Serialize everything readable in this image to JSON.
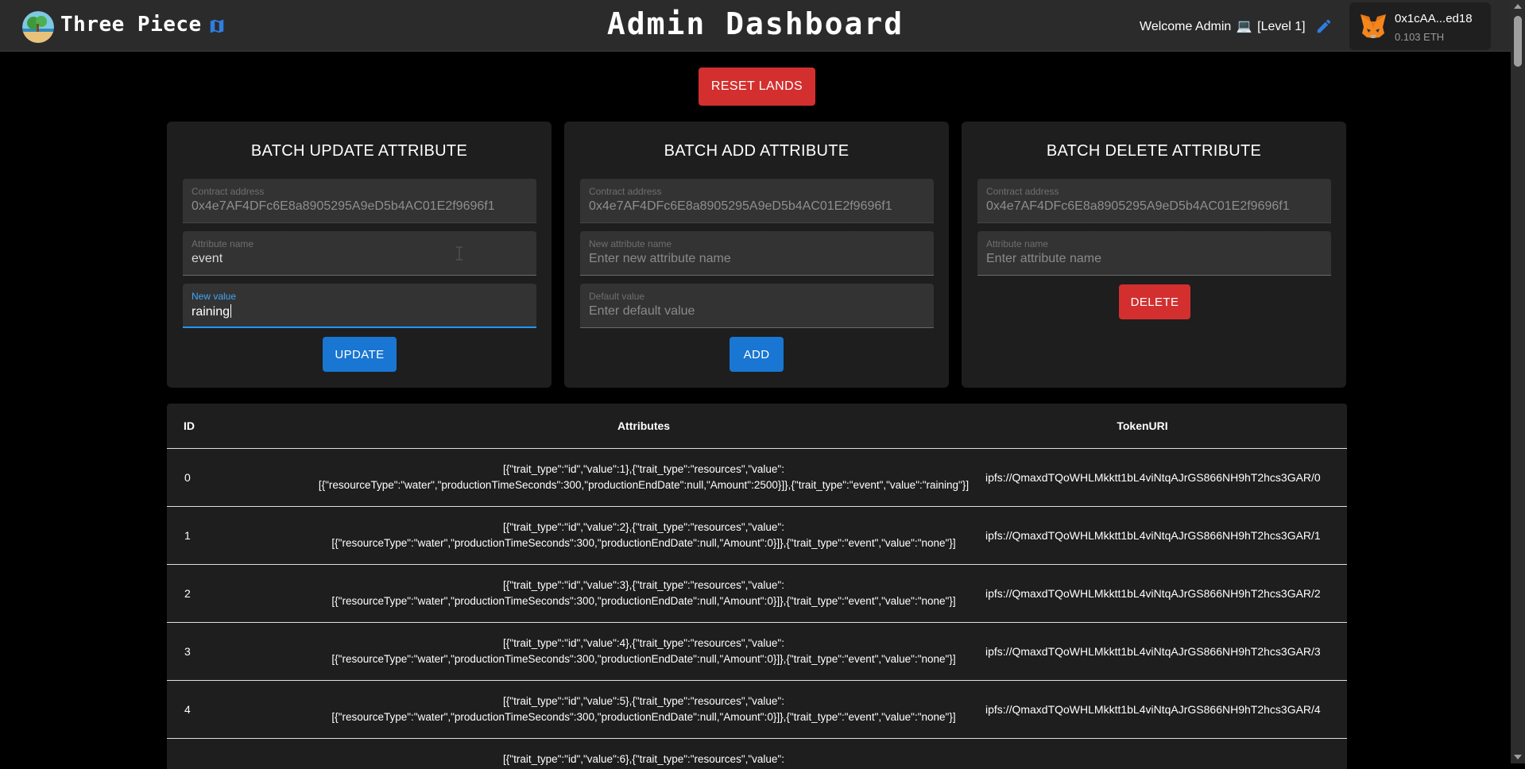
{
  "header": {
    "brand": "Three Piece",
    "title": "Admin Dashboard",
    "welcome": "Welcome Admin",
    "welcome_emoji": "💻",
    "level": "[Level 1]",
    "wallet_address": "0x1cAA...ed18",
    "wallet_balance": "0.103 ETH"
  },
  "actions": {
    "reset_label": "RESET LANDS"
  },
  "panels": {
    "update": {
      "title": "BATCH UPDATE ATTRIBUTE",
      "contract_label": "Contract address",
      "contract_value": "0x4e7AF4DFc6E8a8905295A9eD5b4AC01E2f9696f1",
      "attr_label": "Attribute name",
      "attr_value": "event",
      "new_value_label": "New value",
      "new_value": "raining",
      "button": "UPDATE"
    },
    "add": {
      "title": "BATCH ADD ATTRIBUTE",
      "contract_label": "Contract address",
      "contract_value": "0x4e7AF4DFc6E8a8905295A9eD5b4AC01E2f9696f1",
      "attr_label": "New attribute name",
      "attr_placeholder": "Enter new attribute name",
      "default_label": "Default value",
      "default_placeholder": "Enter default value",
      "button": "ADD"
    },
    "delete": {
      "title": "BATCH DELETE ATTRIBUTE",
      "contract_label": "Contract address",
      "contract_value": "0x4e7AF4DFc6E8a8905295A9eD5b4AC01E2f9696f1",
      "attr_label": "Attribute name",
      "attr_placeholder": "Enter attribute name",
      "button": "DELETE"
    }
  },
  "table": {
    "headers": {
      "id": "ID",
      "attributes": "Attributes",
      "token_uri": "TokenURI"
    },
    "rows": [
      {
        "id": "0",
        "attr_line1": "[{\"trait_type\":\"id\",\"value\":1},{\"trait_type\":\"resources\",\"value\":",
        "attr_line2": "[{\"resourceType\":\"water\",\"productionTimeSeconds\":300,\"productionEndDate\":null,\"Amount\":2500}]},{\"trait_type\":\"event\",\"value\":\"raining\"}]",
        "uri": "ipfs://QmaxdTQoWHLMkktt1bL4viNtqAJrGS866NH9hT2hcs3GAR/0"
      },
      {
        "id": "1",
        "attr_line1": "[{\"trait_type\":\"id\",\"value\":2},{\"trait_type\":\"resources\",\"value\":",
        "attr_line2": "[{\"resourceType\":\"water\",\"productionTimeSeconds\":300,\"productionEndDate\":null,\"Amount\":0}]},{\"trait_type\":\"event\",\"value\":\"none\"}]",
        "uri": "ipfs://QmaxdTQoWHLMkktt1bL4viNtqAJrGS866NH9hT2hcs3GAR/1"
      },
      {
        "id": "2",
        "attr_line1": "[{\"trait_type\":\"id\",\"value\":3},{\"trait_type\":\"resources\",\"value\":",
        "attr_line2": "[{\"resourceType\":\"water\",\"productionTimeSeconds\":300,\"productionEndDate\":null,\"Amount\":0}]},{\"trait_type\":\"event\",\"value\":\"none\"}]",
        "uri": "ipfs://QmaxdTQoWHLMkktt1bL4viNtqAJrGS866NH9hT2hcs3GAR/2"
      },
      {
        "id": "3",
        "attr_line1": "[{\"trait_type\":\"id\",\"value\":4},{\"trait_type\":\"resources\",\"value\":",
        "attr_line2": "[{\"resourceType\":\"water\",\"productionTimeSeconds\":300,\"productionEndDate\":null,\"Amount\":0}]},{\"trait_type\":\"event\",\"value\":\"none\"}]",
        "uri": "ipfs://QmaxdTQoWHLMkktt1bL4viNtqAJrGS866NH9hT2hcs3GAR/3"
      },
      {
        "id": "4",
        "attr_line1": "[{\"trait_type\":\"id\",\"value\":5},{\"trait_type\":\"resources\",\"value\":",
        "attr_line2": "[{\"resourceType\":\"water\",\"productionTimeSeconds\":300,\"productionEndDate\":null,\"Amount\":0}]},{\"trait_type\":\"event\",\"value\":\"none\"}]",
        "uri": "ipfs://QmaxdTQoWHLMkktt1bL4viNtqAJrGS866NH9hT2hcs3GAR/4"
      },
      {
        "id": "",
        "attr_line1": "[{\"trait_type\":\"id\",\"value\":6},{\"trait_type\":\"resources\",\"value\":",
        "attr_line2": "",
        "uri": ""
      }
    ]
  },
  "colors": {
    "header_bg": "#2b2b2b",
    "panel_bg": "#1e1e1e",
    "primary": "#1976d2",
    "danger": "#d32f2f",
    "focus": "#2196f3"
  }
}
